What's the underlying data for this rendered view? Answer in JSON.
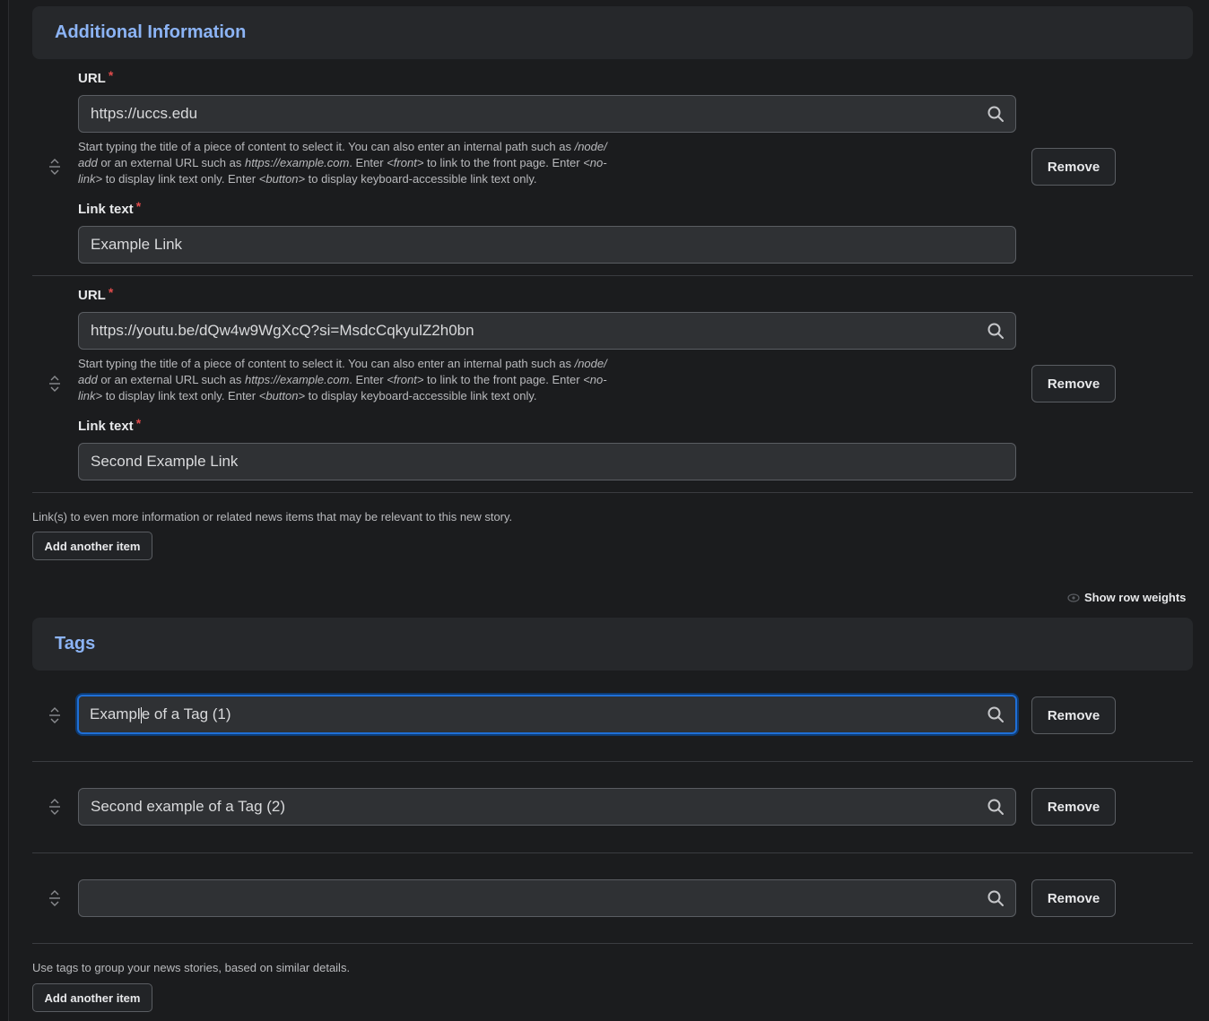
{
  "additional_info": {
    "title": "Additional Information",
    "items": [
      {
        "url_label": "URL",
        "url_value": "https://uccs.edu",
        "link_text_label": "Link text",
        "link_text_value": "Example Link",
        "remove_label": "Remove"
      },
      {
        "url_label": "URL",
        "url_value": "https://youtu.be/dQw4w9WgXcQ?si=MsdcCqkyulZ2h0bn",
        "link_text_label": "Link text",
        "link_text_value": "Second Example Link",
        "remove_label": "Remove"
      }
    ],
    "help": {
      "p1": "Start typing the title of a piece of content to select it. You can also enter an internal path such as ",
      "path1": "/node/",
      "path2": "add",
      "p2": " or an external URL such as ",
      "example_url": "https://example.com",
      "p3": ". Enter ",
      "front": "<front>",
      "p4": " to link to the front page. Enter ",
      "nolink1": "<no-",
      "nolink2": "link>",
      "p5": " to display link text only. Enter ",
      "button": "<button>",
      "p6": " to display keyboard-accessible link text only."
    },
    "description": "Link(s) to even more information or related news items that may be relevant to this new story.",
    "add_label": "Add another item"
  },
  "show_row_weights": "Show row weights",
  "tags": {
    "title": "Tags",
    "items": [
      {
        "value_before_caret": "Exampl",
        "value_after_caret": "e of a Tag (1)",
        "remove_label": "Remove",
        "focused": true
      },
      {
        "value": "Second example of a Tag (2)",
        "remove_label": "Remove"
      },
      {
        "value": "",
        "remove_label": "Remove"
      }
    ],
    "description": "Use tags to group your news stories, based on similar details.",
    "add_label": "Add another item"
  },
  "colors": {
    "background": "#1b1c1e",
    "section_header": "#26282b",
    "section_title": "#8cb4f5",
    "input_bg": "#2f3134",
    "required": "#e04b4b",
    "focus": "#1f6fd6"
  },
  "icons": {
    "search": "search-icon",
    "drag": "drag-handle-icon",
    "eye": "eye-icon"
  }
}
